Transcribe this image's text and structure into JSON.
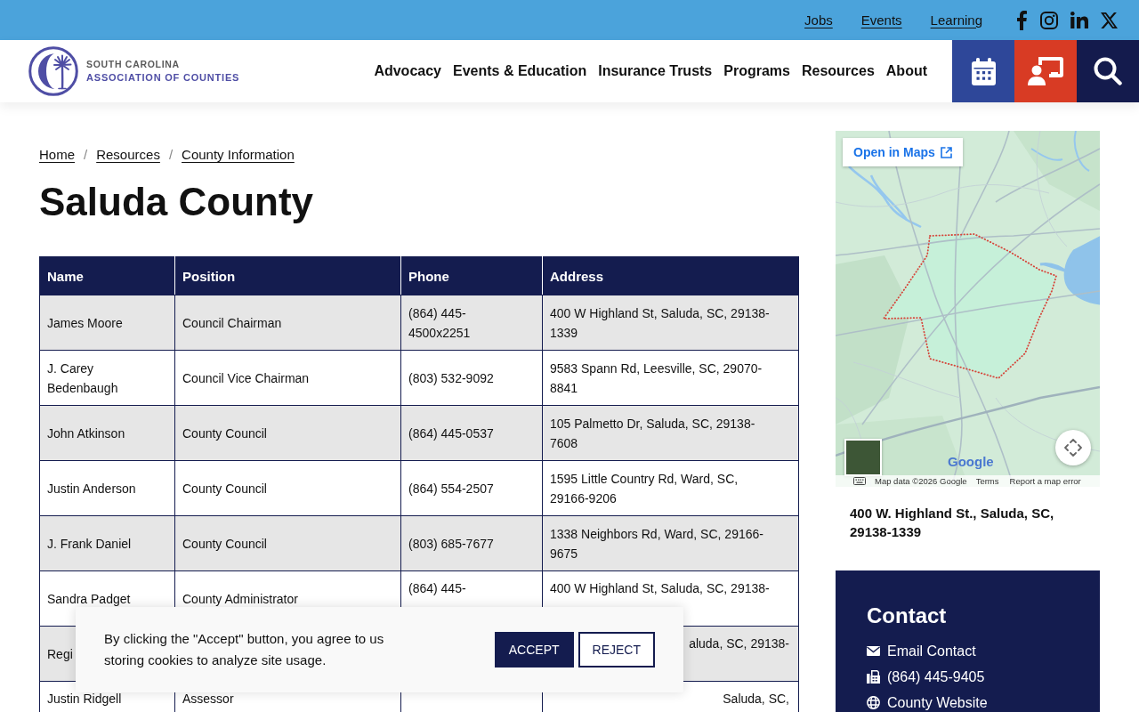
{
  "top_bar": {
    "links": [
      "Jobs",
      "Events",
      "Learning"
    ]
  },
  "header": {
    "logo": {
      "line_1": "SOUTH CAROLINA",
      "line_2": "ASSOCIATION OF COUNTIES"
    },
    "nav": [
      "Advocacy",
      "Events & Education",
      "Insurance Trusts",
      "Programs",
      "Resources",
      "About"
    ]
  },
  "breadcrumb": {
    "items": [
      "Home",
      "Resources",
      "County Information"
    ],
    "separators": [
      "/",
      "/"
    ]
  },
  "title": "Saluda County",
  "table": {
    "columns": [
      "Name",
      "Position",
      "Phone",
      "Address"
    ],
    "rows": [
      {
        "name": "James Moore",
        "position": "Council Chairman",
        "phone": "(864) 445-4500x2251",
        "address": "400 W Highland St, Saluda, SC, 29138-1339"
      },
      {
        "name": "J. Carey Bedenbaugh",
        "position": "Council Vice Chairman",
        "phone": "(803) 532-9092",
        "address": "9583 Spann Rd, Leesville, SC, 29070-8841"
      },
      {
        "name": "John Atkinson",
        "position": "County Council",
        "phone": "(864) 445-0537",
        "address": "105 Palmetto Dr, Saluda, SC, 29138-7608"
      },
      {
        "name": "Justin Anderson",
        "position": "County Council",
        "phone": "(864) 554-2507",
        "address": "1595 Little Country Rd, Ward, SC, 29166-9206"
      },
      {
        "name": "J. Frank Daniel",
        "position": "County Council",
        "phone": "(803) 685-7677",
        "address": "1338 Neighbors Rd, Ward, SC, 29166-9675"
      },
      {
        "name": "Sandra Padget",
        "position": "County Administrator",
        "phone": {
          "text": "(864) 445-",
          "clipped_end": true
        },
        "address": {
          "text": "400 W Highland St, Saluda, SC, 29138-",
          "clipped_end": true
        }
      },
      {
        "name": "Regi",
        "address": {
          "text": "aluda, SC, 29138-",
          "clipped_start": true
        }
      },
      {
        "name": {
          "text": "Justin Ridgell",
          "clipped_end": true
        },
        "position": {
          "text": "Assessor",
          "clipped_end": true
        },
        "address": {
          "text": "Saluda, SC,",
          "clipped_start": true
        }
      }
    ]
  },
  "map": {
    "open_button": "Open in Maps",
    "logo": "Google",
    "attribution": "Map data ©2026 Google",
    "terms": "Terms",
    "report": "Report a map error"
  },
  "address": "400 W. Highland St., Saluda, SC, 29138-1339",
  "contact": {
    "title": "Contact",
    "items": [
      {
        "kind": "email",
        "label": "Email Contact"
      },
      {
        "kind": "phone",
        "label": "(864) 445-9405"
      },
      {
        "kind": "website",
        "label": "County Website"
      }
    ]
  },
  "cookie_banner": {
    "message": "By clicking the \"Accept\" button, you agree to us storing cookies to analyze site usage.",
    "buttons": [
      {
        "kind": "primary",
        "label": "ACCEPT"
      },
      {
        "kind": "secondary",
        "label": "REJECT"
      }
    ]
  }
}
